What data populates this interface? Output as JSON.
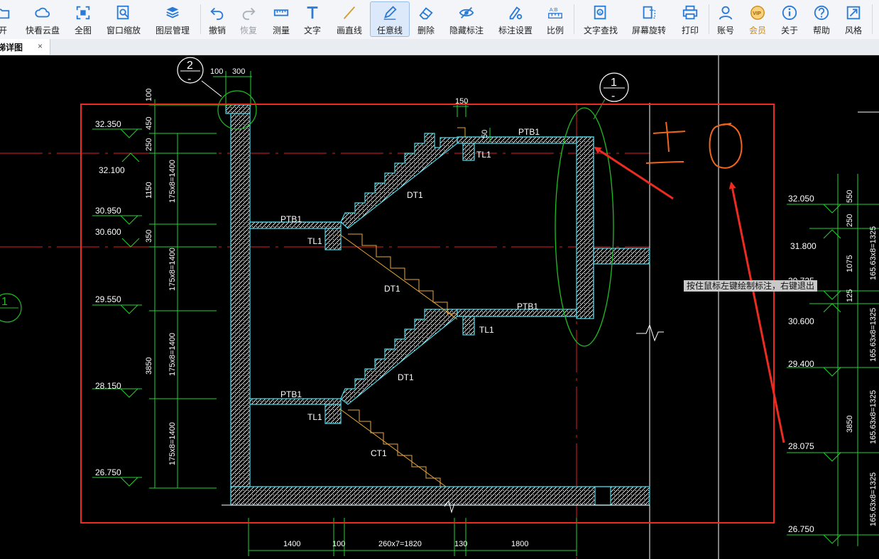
{
  "toolbar": {
    "items": [
      {
        "label": "打开",
        "icon": "open-icon",
        "display": "开"
      },
      {
        "label": "快看云盘",
        "icon": "cloud-icon"
      },
      {
        "label": "全图",
        "icon": "full-view-icon"
      },
      {
        "label": "窗口缩放",
        "icon": "zoom-window-icon"
      },
      {
        "label": "图层管理",
        "icon": "layers-icon"
      },
      {
        "label": "撤销",
        "icon": "undo-icon"
      },
      {
        "label": "恢复",
        "icon": "redo-icon"
      },
      {
        "label": "测量",
        "icon": "ruler-icon"
      },
      {
        "label": "文字",
        "icon": "text-icon"
      },
      {
        "label": "画直线",
        "icon": "line-icon"
      },
      {
        "label": "任意线",
        "icon": "freehand-pen-icon",
        "active": true
      },
      {
        "label": "删除",
        "icon": "eraser-icon"
      },
      {
        "label": "隐藏标注",
        "icon": "hide-eye-icon"
      },
      {
        "label": "标注设置",
        "icon": "annotation-settings-icon"
      },
      {
        "label": "比例",
        "icon": "scale-icon"
      },
      {
        "label": "文字查找",
        "icon": "text-search-icon"
      },
      {
        "label": "屏幕旋转",
        "icon": "rotate-screen-icon"
      },
      {
        "label": "打印",
        "icon": "printer-icon"
      },
      {
        "label": "账号",
        "icon": "user-icon"
      },
      {
        "label": "会员",
        "icon": "vip-icon"
      },
      {
        "label": "关于",
        "icon": "info-icon"
      },
      {
        "label": "帮助",
        "icon": "help-icon"
      },
      {
        "label": "风格",
        "icon": "style-icon"
      }
    ]
  },
  "tabs": [
    {
      "title": "楼梯详图",
      "display": "梯详图",
      "close": "×"
    }
  ],
  "tooltip": "按住鼠标左键绘制标注，右键退出",
  "colors": {
    "background": "#000000",
    "wall_outline": "#47d9e8",
    "dimension": "#22d332",
    "text": "#ffffff",
    "axis": "#e01e1e",
    "highlight_ellipse": "#1fbd22",
    "markup_red": "#ec2b21",
    "markup_orange": "#f0661f",
    "stair_line": "#e8a63a"
  },
  "drawing": {
    "elevations_left": [
      "32.350",
      "32.100",
      "30.950",
      "30.600",
      "29.550",
      "28.150",
      "26.750"
    ],
    "elevations_right": [
      "32.050",
      "31.800",
      "30.725",
      "30.600",
      "29.400",
      "28.075",
      "26.750"
    ],
    "dims_left_outer": [
      "100",
      "450",
      "250",
      "1150",
      "350",
      "3850"
    ],
    "dims_left_inner": [
      "175x8=1400",
      "175x8=1400",
      "175x8=1400",
      "175x8=1400"
    ],
    "dims_right_outer": [
      "550",
      "250",
      "1075",
      "125",
      "3850"
    ],
    "dims_right_inner": [
      "165.63x8=1325",
      "165.63x8=1325",
      "165.63x8=1325",
      "165.63x8=1325"
    ],
    "dims_bottom": [
      "1400",
      "100",
      "260x7=1820",
      "130",
      "1800"
    ],
    "dims_top": [
      "100",
      "300",
      "150",
      "50"
    ],
    "section_marks": [
      {
        "number": "2",
        "sub": "-"
      },
      {
        "number": "1",
        "sub": "-"
      },
      {
        "number": "1",
        "sub": ""
      }
    ],
    "labels": {
      "ptb1": "PTB1",
      "tl1": "TL1",
      "dt1": "DT1",
      "ct1": "CT1"
    },
    "markup_text": "±0"
  }
}
